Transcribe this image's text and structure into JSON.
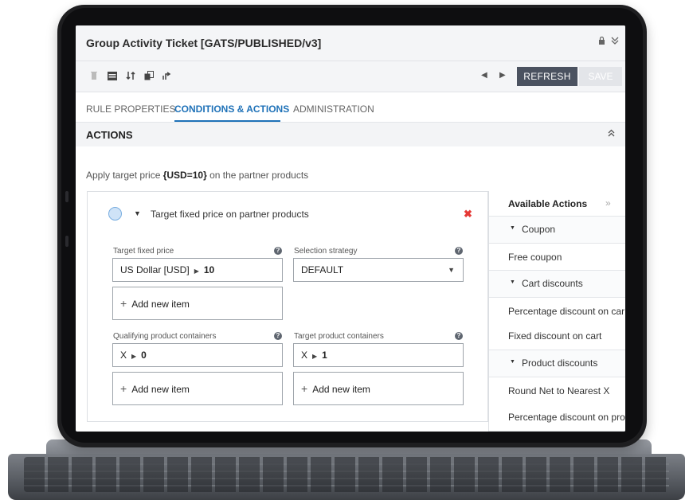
{
  "window": {
    "title": "Group Activity Ticket [GATS/PUBLISHED/v3]"
  },
  "header_icons": [
    "lock-icon",
    "chevron-double-down-icon"
  ],
  "toolbar": {
    "icons": [
      "trash-icon",
      "calendar-icon",
      "import-icon",
      "copy-icon",
      "share-icon"
    ],
    "refresh_label": "REFRESH",
    "save_label": "SAVE"
  },
  "tabs": [
    {
      "label": "RULE PROPERTIES",
      "active": false
    },
    {
      "label": "CONDITIONS & ACTIONS",
      "active": true
    },
    {
      "label": "ADMINISTRATION",
      "active": false
    }
  ],
  "actions": {
    "section_title": "ACTIONS",
    "summary_prefix": "Apply target price ",
    "summary_value": "{USD=10}",
    "summary_suffix": " on the partner products",
    "rule": {
      "name": "Target fixed price on partner products",
      "target_fixed_price": {
        "label": "Target fixed price",
        "currency": "US Dollar [USD]",
        "value": "10"
      },
      "selection_strategy": {
        "label": "Selection strategy",
        "value": "DEFAULT"
      },
      "add_new_item_label": "Add new item",
      "qualifying_containers": {
        "label": "Qualifying product containers",
        "key": "X",
        "value": "0"
      },
      "target_containers": {
        "label": "Target product containers",
        "key": "X",
        "value": "1"
      }
    }
  },
  "available_actions": {
    "title": "Available Actions",
    "items": [
      {
        "label": "Coupon",
        "type": "category"
      },
      {
        "label": "Free coupon",
        "type": "item"
      },
      {
        "label": "Cart discounts",
        "type": "category"
      },
      {
        "label": "Percentage discount on car",
        "type": "item"
      },
      {
        "label": "Fixed discount on cart",
        "type": "item"
      },
      {
        "label": "Product discounts",
        "type": "category"
      },
      {
        "label": "Round Net to Nearest X",
        "type": "item"
      },
      {
        "label": "Percentage discount on pro",
        "type": "item"
      }
    ]
  },
  "colors": {
    "accent": "#1f72b8",
    "delete": "#e53935",
    "refresh_bg": "#4b5260"
  }
}
